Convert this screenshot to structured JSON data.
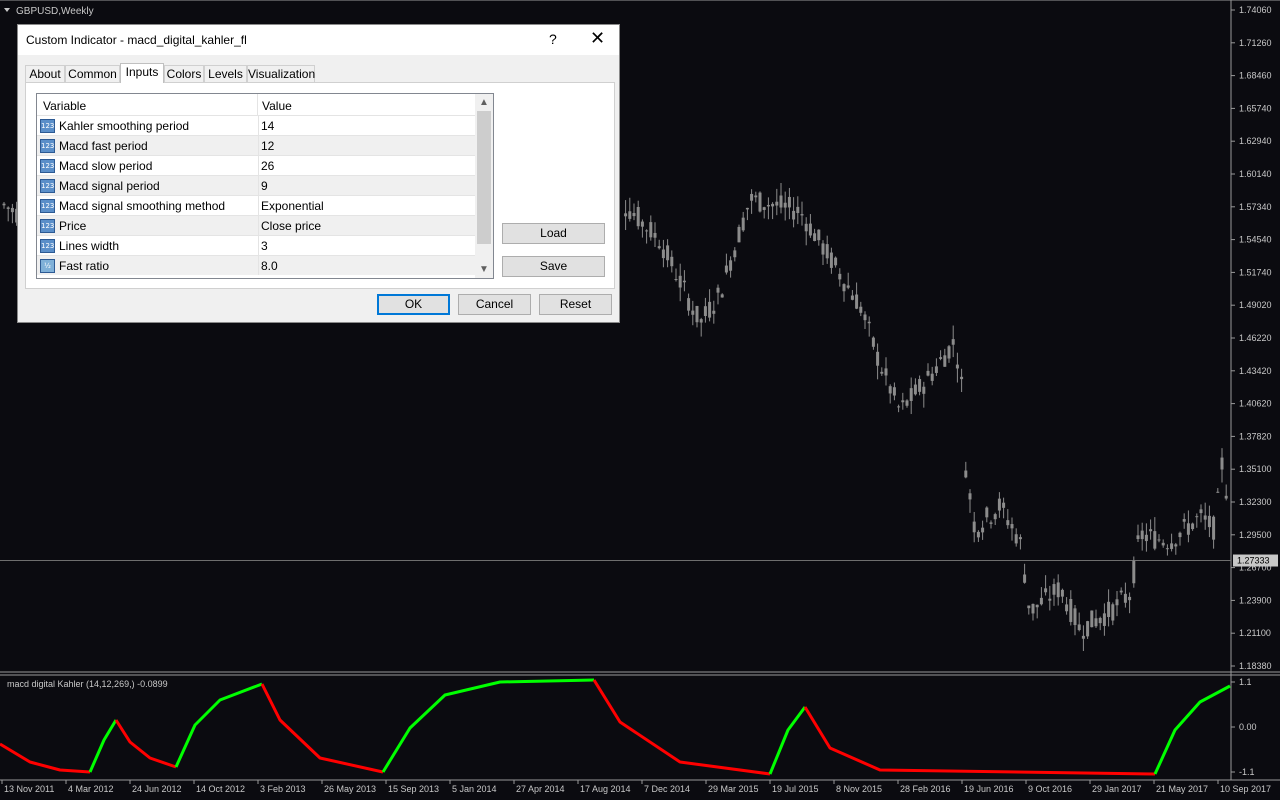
{
  "chart_title": "GBPUSD,Weekly",
  "price_axis": [
    "1.74060",
    "1.71260",
    "1.68460",
    "1.65740",
    "1.62940",
    "1.60140",
    "1.57340",
    "1.54540",
    "1.51740",
    "1.49020",
    "1.46220",
    "1.43420",
    "1.40620",
    "1.37820",
    "1.35100",
    "1.32300",
    "1.29500",
    "1.26700",
    "1.23900",
    "1.21100",
    "1.18380"
  ],
  "current_price": "1.27333",
  "indicator_label": "macd digital Kahler (14,12,269,) -0.0899",
  "indicator_axis": [
    "1.1",
    "0.00",
    "-1.1"
  ],
  "time_axis": [
    "13 Nov 2011",
    "4 Mar 2012",
    "24 Jun 2012",
    "14 Oct 2012",
    "3 Feb 2013",
    "26 May 2013",
    "15 Sep 2013",
    "5 Jan 2014",
    "27 Apr 2014",
    "17 Aug 2014",
    "7 Dec 2014",
    "29 Mar 2015",
    "19 Jul 2015",
    "8 Nov 2015",
    "28 Feb 2016",
    "19 Jun 2016",
    "9 Oct 2016",
    "29 Jan 2017",
    "21 May 2017",
    "10 Sep 2017"
  ],
  "colors": {
    "bull": "#00ff00",
    "bear": "#ff0000",
    "candle": "#8c8c8c",
    "background": "#0b0b10",
    "axis_text": "#c8c8c8"
  },
  "dialog": {
    "title": "Custom Indicator - macd_digital_kahler_fl",
    "help": "?",
    "close": "✕",
    "tabs": [
      "About",
      "Common",
      "Inputs",
      "Colors",
      "Levels",
      "Visualization"
    ],
    "active_tab": "Inputs",
    "columns": {
      "variable": "Variable",
      "value": "Value"
    },
    "params": [
      {
        "name": "Kahler smoothing period",
        "value": "14",
        "icon": "123"
      },
      {
        "name": "Macd fast period",
        "value": "12",
        "icon": "123"
      },
      {
        "name": "Macd slow period",
        "value": "26",
        "icon": "123"
      },
      {
        "name": "Macd signal period",
        "value": "9",
        "icon": "123"
      },
      {
        "name": "Macd signal smoothing method",
        "value": "Exponential",
        "icon": "123"
      },
      {
        "name": "Price",
        "value": "Close price",
        "icon": "123"
      },
      {
        "name": "Lines width",
        "value": "3",
        "icon": "123"
      },
      {
        "name": "Fast ratio",
        "value": "8.0",
        "icon": "½"
      }
    ],
    "buttons": {
      "load": "Load",
      "save": "Save",
      "ok": "OK",
      "cancel": "Cancel",
      "reset": "Reset"
    }
  }
}
